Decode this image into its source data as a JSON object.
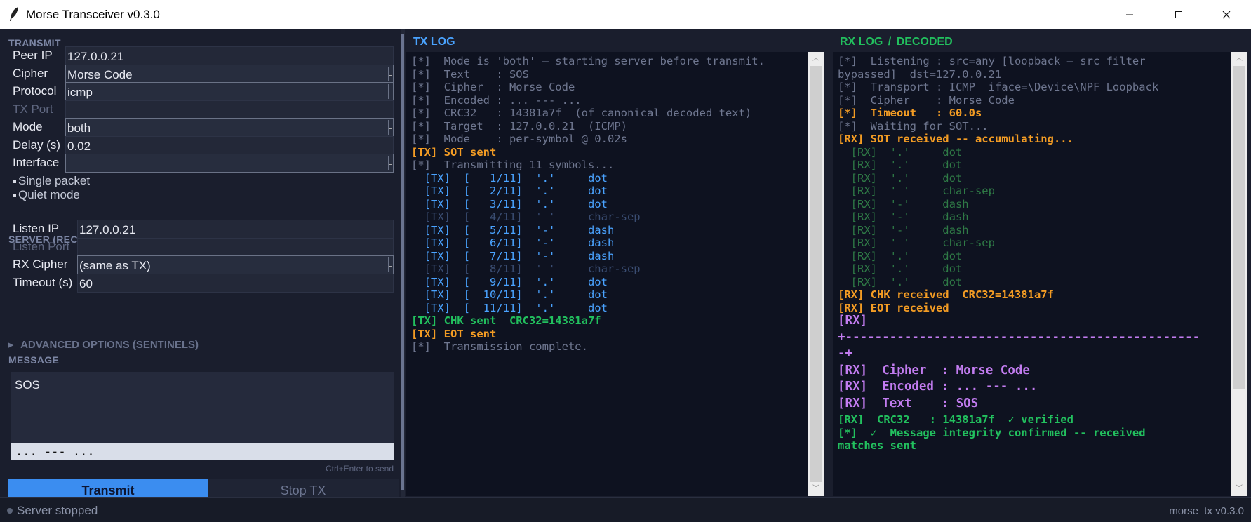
{
  "window": {
    "title": "Morse Transceiver  v0.3.0"
  },
  "transmit": {
    "heading": "TRANSMIT",
    "fields": [
      {
        "label": "Peer IP",
        "value": "127.0.0.21",
        "kind": "text"
      },
      {
        "label": "Cipher",
        "value": "Morse Code",
        "kind": "combo"
      },
      {
        "label": "Protocol",
        "value": "icmp",
        "kind": "combo"
      },
      {
        "label": "TX Port",
        "value": "",
        "kind": "disabled"
      },
      {
        "label": "Mode",
        "value": "both",
        "kind": "combo"
      },
      {
        "label": "Delay (s)",
        "value": "0.02",
        "kind": "text"
      },
      {
        "label": "Interface",
        "value": "",
        "kind": "combo"
      }
    ],
    "checks": [
      "Single packet",
      "Quiet mode"
    ]
  },
  "server": {
    "heading": "SERVER  (RECEIVE)",
    "fields": [
      {
        "label": "Listen IP",
        "value": "127.0.0.21",
        "kind": "text"
      },
      {
        "label": "Listen Port",
        "value": "",
        "kind": "disabled"
      },
      {
        "label": "RX Cipher",
        "value": "(same as TX)",
        "kind": "combo"
      },
      {
        "label": "Timeout (s)",
        "value": "60",
        "kind": "text"
      }
    ]
  },
  "advanced": {
    "label": "ADVANCED OPTIONS  (SENTINELS)"
  },
  "message": {
    "heading": "MESSAGE",
    "text": "SOS",
    "morse": "... --- ...",
    "hint": "Ctrl+Enter to send"
  },
  "buttons": {
    "transmit": "Transmit",
    "stop": "Stop TX"
  },
  "tx_log": {
    "title": "TX LOG",
    "lines": [
      {
        "text": "[*]  Mode is 'both' — starting server before transmit.",
        "style": "gray"
      },
      {
        "text": "[*]  Text    : SOS",
        "style": "gray"
      },
      {
        "text": "[*]  Cipher  : Morse Code",
        "style": "gray"
      },
      {
        "text": "[*]  Encoded : ... --- ...",
        "style": "gray"
      },
      {
        "text": "[*]  CRC32   : 14381a7f  (of canonical decoded text)",
        "style": "gray"
      },
      {
        "text": "[*]  Target  : 127.0.0.21  (ICMP)",
        "style": "gray"
      },
      {
        "text": "[*]  Mode    : per-symbol @ 0.02s",
        "style": "gray"
      },
      {
        "text": "[TX] SOT sent",
        "style": "orange"
      },
      {
        "text": "[*]  Transmitting 11 symbols...",
        "style": "gray"
      },
      {
        "text": "  [TX]  [   1/11]  '.'     dot",
        "style": "blue"
      },
      {
        "text": "  [TX]  [   2/11]  '.'     dot",
        "style": "blue"
      },
      {
        "text": "  [TX]  [   3/11]  '.'     dot",
        "style": "blue"
      },
      {
        "text": "  [TX]  [   4/11]  ' '     char-sep",
        "style": "dimblue"
      },
      {
        "text": "  [TX]  [   5/11]  '-'     dash",
        "style": "blue"
      },
      {
        "text": "  [TX]  [   6/11]  '-'     dash",
        "style": "blue"
      },
      {
        "text": "  [TX]  [   7/11]  '-'     dash",
        "style": "blue"
      },
      {
        "text": "  [TX]  [   8/11]  ' '     char-sep",
        "style": "dimblue"
      },
      {
        "text": "  [TX]  [   9/11]  '.'     dot",
        "style": "blue"
      },
      {
        "text": "  [TX]  [  10/11]  '.'     dot",
        "style": "blue"
      },
      {
        "text": "  [TX]  [  11/11]  '.'     dot",
        "style": "blue"
      },
      {
        "text": "[TX] CHK sent  CRC32=14381a7f",
        "style": "green"
      },
      {
        "text": "[TX] EOT sent",
        "style": "orange"
      },
      {
        "text": "[*]  Transmission complete.",
        "style": "gray"
      }
    ]
  },
  "rx_log": {
    "title_part1": "RX LOG",
    "title_sep": "/",
    "title_part2": "DECODED",
    "lines": [
      {
        "text": "[*]  Listening : src=any [loopback — src filter",
        "style": "gray"
      },
      {
        "text": "bypassed]  dst=127.0.0.21",
        "style": "gray"
      },
      {
        "text": "[*]  Transport : ICMP  iface=\\Device\\NPF_Loopback",
        "style": "gray"
      },
      {
        "text": "[*]  Cipher    : Morse Code",
        "style": "gray"
      },
      {
        "text": "[*]  Timeout   : 60.0s",
        "style": "orange"
      },
      {
        "text": "[*]  Waiting for SOT...",
        "style": "gray"
      },
      {
        "text": "[RX] SOT received -- accumulating...",
        "style": "orange"
      },
      {
        "text": "  [RX]  '.'     dot",
        "style": "dimgreen"
      },
      {
        "text": "  [RX]  '.'     dot",
        "style": "dimgreen"
      },
      {
        "text": "  [RX]  '.'     dot",
        "style": "dimgreen"
      },
      {
        "text": "  [RX]  ' '     char-sep",
        "style": "dimgreen"
      },
      {
        "text": "  [RX]  '-'     dash",
        "style": "dimgreen"
      },
      {
        "text": "  [RX]  '-'     dash",
        "style": "dimgreen"
      },
      {
        "text": "  [RX]  '-'     dash",
        "style": "dimgreen"
      },
      {
        "text": "  [RX]  ' '     char-sep",
        "style": "dimgreen"
      },
      {
        "text": "  [RX]  '.'     dot",
        "style": "dimgreen"
      },
      {
        "text": "  [RX]  '.'     dot",
        "style": "dimgreen"
      },
      {
        "text": "  [RX]  '.'     dot",
        "style": "dimgreen"
      },
      {
        "text": "[RX] CHK received  CRC32=14381a7f",
        "style": "orange"
      },
      {
        "text": "[RX] EOT received",
        "style": "orange"
      },
      {
        "text": "[RX]",
        "style": "purple-big"
      },
      {
        "text": "+------------------------------------------------",
        "style": "purple-big"
      },
      {
        "text": "-+",
        "style": "purple-big"
      },
      {
        "text": "[RX]  Cipher  : Morse Code",
        "style": "purple-big"
      },
      {
        "text": "[RX]  Encoded : ... --- ...",
        "style": "purple-big"
      },
      {
        "text": "[RX]  Text    : SOS",
        "style": "purple-big"
      },
      {
        "text": "[RX]  CRC32   : 14381a7f  ✓ verified",
        "style": "green"
      },
      {
        "text": "[*]  ✓  Message integrity confirmed -- received",
        "style": "green"
      },
      {
        "text": "matches sent",
        "style": "green"
      }
    ]
  },
  "status": {
    "text": "Server stopped",
    "version": "morse_tx v0.3.0"
  },
  "colors": {
    "accent": "#3b8df0",
    "tx_title": "#4aa3ff",
    "rx_title": "#22c05e",
    "orange": "#f39c24",
    "purple": "#c27cf0"
  }
}
